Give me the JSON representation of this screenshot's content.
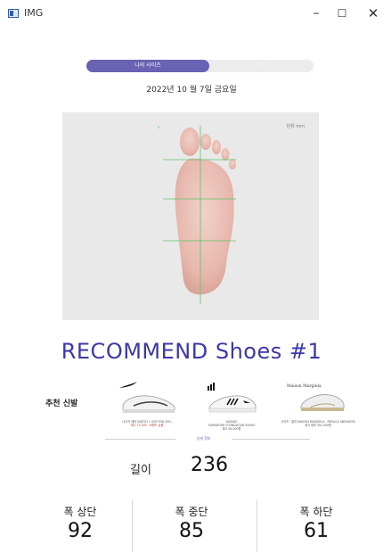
{
  "window": {
    "title": "IMG",
    "minimize_glyph": "–",
    "maximize_glyph": "☐",
    "close_glyph": "✕"
  },
  "toggle": {
    "left_label": "나의 사이즈",
    "right_label": "추천"
  },
  "date": "2022년 10 월 7일 금요일",
  "foot_panel": {
    "unit_label": "단위 mm"
  },
  "recommend": {
    "title": "RECOMMEND Shoes #1",
    "section_label": "추천 신발",
    "shoes": [
      {
        "icon": "nike-sneaker-icon",
        "caption_line1": "나이키 에어 트레이너 1 (DH7338-100)",
        "caption_line2": "재고 75,000 · 브랜드 상품",
        "brand": "Nike"
      },
      {
        "icon": "adidas-sneaker-icon",
        "caption_line1": "ADIDAS",
        "caption_line2": "SUPERSTAR FOUNDATION SHOES",
        "caption_line3": "재고       99,000원",
        "brand": "adidas"
      },
      {
        "icon": "maison-margiela-sneaker-icon",
        "caption_line1": "사이즈 · 컬러      MAISON MARGIELA · REPLICA SNEAKERS",
        "caption_line2": "재고 정보            551,000원",
        "brand": "Maison Margiela"
      }
    ]
  },
  "detail": {
    "label": "상세 정보"
  },
  "measurements": {
    "length_label": "길이",
    "length_value": "236",
    "width_top_label": "폭 상단",
    "width_top_value": "92",
    "width_mid_label": "폭 중단",
    "width_mid_value": "85",
    "width_bottom_label": "폭 하단",
    "width_bottom_value": "61"
  },
  "colors": {
    "accent": "#6a62b2",
    "title": "#3d37a8",
    "panel_bg": "#e9e9e9",
    "guide_line": "#5cc56a"
  }
}
